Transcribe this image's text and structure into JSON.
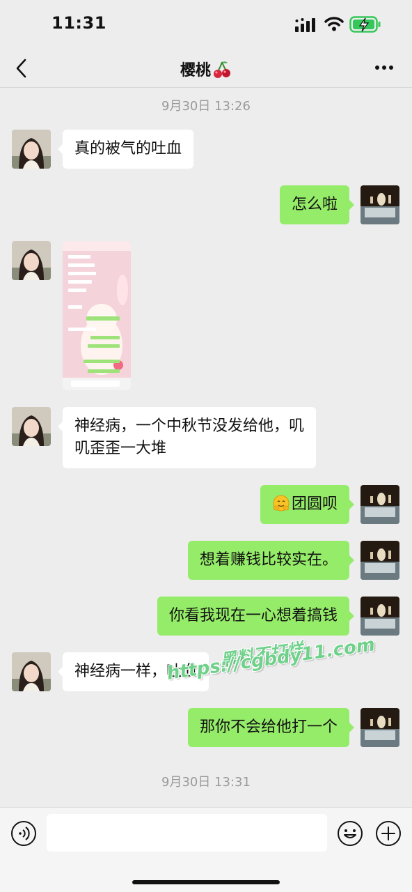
{
  "status_bar": {
    "time": "11:31"
  },
  "header": {
    "title": "樱桃",
    "title_emoji": "cherry"
  },
  "timestamps": [
    "9月30日 13:26",
    "9月30日 13:31"
  ],
  "messages": [
    {
      "side": "left",
      "type": "text",
      "text": "真的被气的吐血"
    },
    {
      "side": "right",
      "type": "text",
      "text": "怎么啦"
    },
    {
      "side": "left",
      "type": "image",
      "description_icon": "chat-screenshot-image"
    },
    {
      "side": "left",
      "type": "text",
      "lines": [
        "神经病，一个中秋节没发给他，叽",
        "叽歪歪一大堆"
      ]
    },
    {
      "side": "right",
      "type": "text",
      "emoji": "hugging-face",
      "text": "团圆呗"
    },
    {
      "side": "right",
      "type": "text",
      "text": "想着赚钱比较实在。"
    },
    {
      "side": "right",
      "type": "text",
      "text": "你看我现在一心想着搞钱"
    },
    {
      "side": "left",
      "type": "text",
      "text": "神经病一样，吐血"
    },
    {
      "side": "right",
      "type": "text",
      "text": "那你不会给他打一个"
    }
  ],
  "watermark": {
    "line1": "黑料不打烊",
    "line2": "https://cgbdy11.com"
  },
  "input": {
    "placeholder": ""
  },
  "colors": {
    "background": "#ededed",
    "bubble_right": "#95ec69",
    "bubble_left": "#ffffff",
    "timestamp": "#9a9a9a"
  }
}
